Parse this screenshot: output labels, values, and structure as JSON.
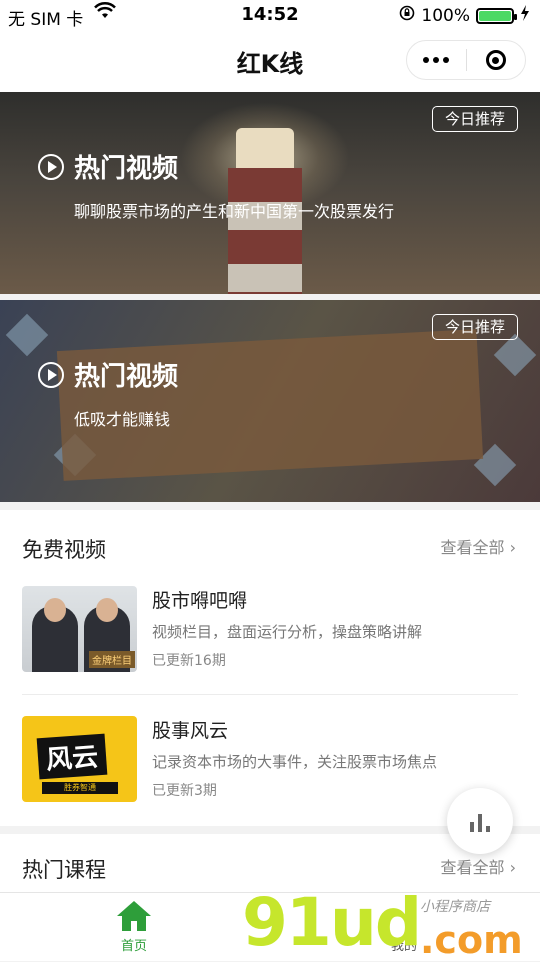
{
  "status": {
    "carrier": "无 SIM 卡",
    "time": "14:52",
    "battery": "100%"
  },
  "nav": {
    "title": "红K线"
  },
  "banners": [
    {
      "tag": "今日推荐",
      "title": "热门视频",
      "subtitle": "聊聊股票市场的产生和新中国第一次股票发行"
    },
    {
      "tag": "今日推荐",
      "title": "热门视频",
      "subtitle": "低吸才能赚钱"
    }
  ],
  "free": {
    "heading": "免费视频",
    "more": "查看全部",
    "items": [
      {
        "title": "股市嘚吧嘚",
        "desc": "视频栏目，盘面运行分析，操盘策略讲解",
        "count": "已更新16期",
        "thumb_tag": "金牌栏目"
      },
      {
        "title": "股事风云",
        "desc": "记录资本市场的大事件，关注股票市场焦点",
        "count": "已更新3期",
        "thumb_text": "风云",
        "thumb_sub": "胜券智通"
      }
    ]
  },
  "hot": {
    "heading": "热门课程",
    "more": "查看全部"
  },
  "tabs": [
    {
      "label": "首页"
    },
    {
      "label": "我的"
    }
  ],
  "watermark": {
    "main": "91ud",
    "sub": ".com",
    "script": "小程序商店"
  },
  "colors": {
    "accent": "#2e9e3a"
  }
}
